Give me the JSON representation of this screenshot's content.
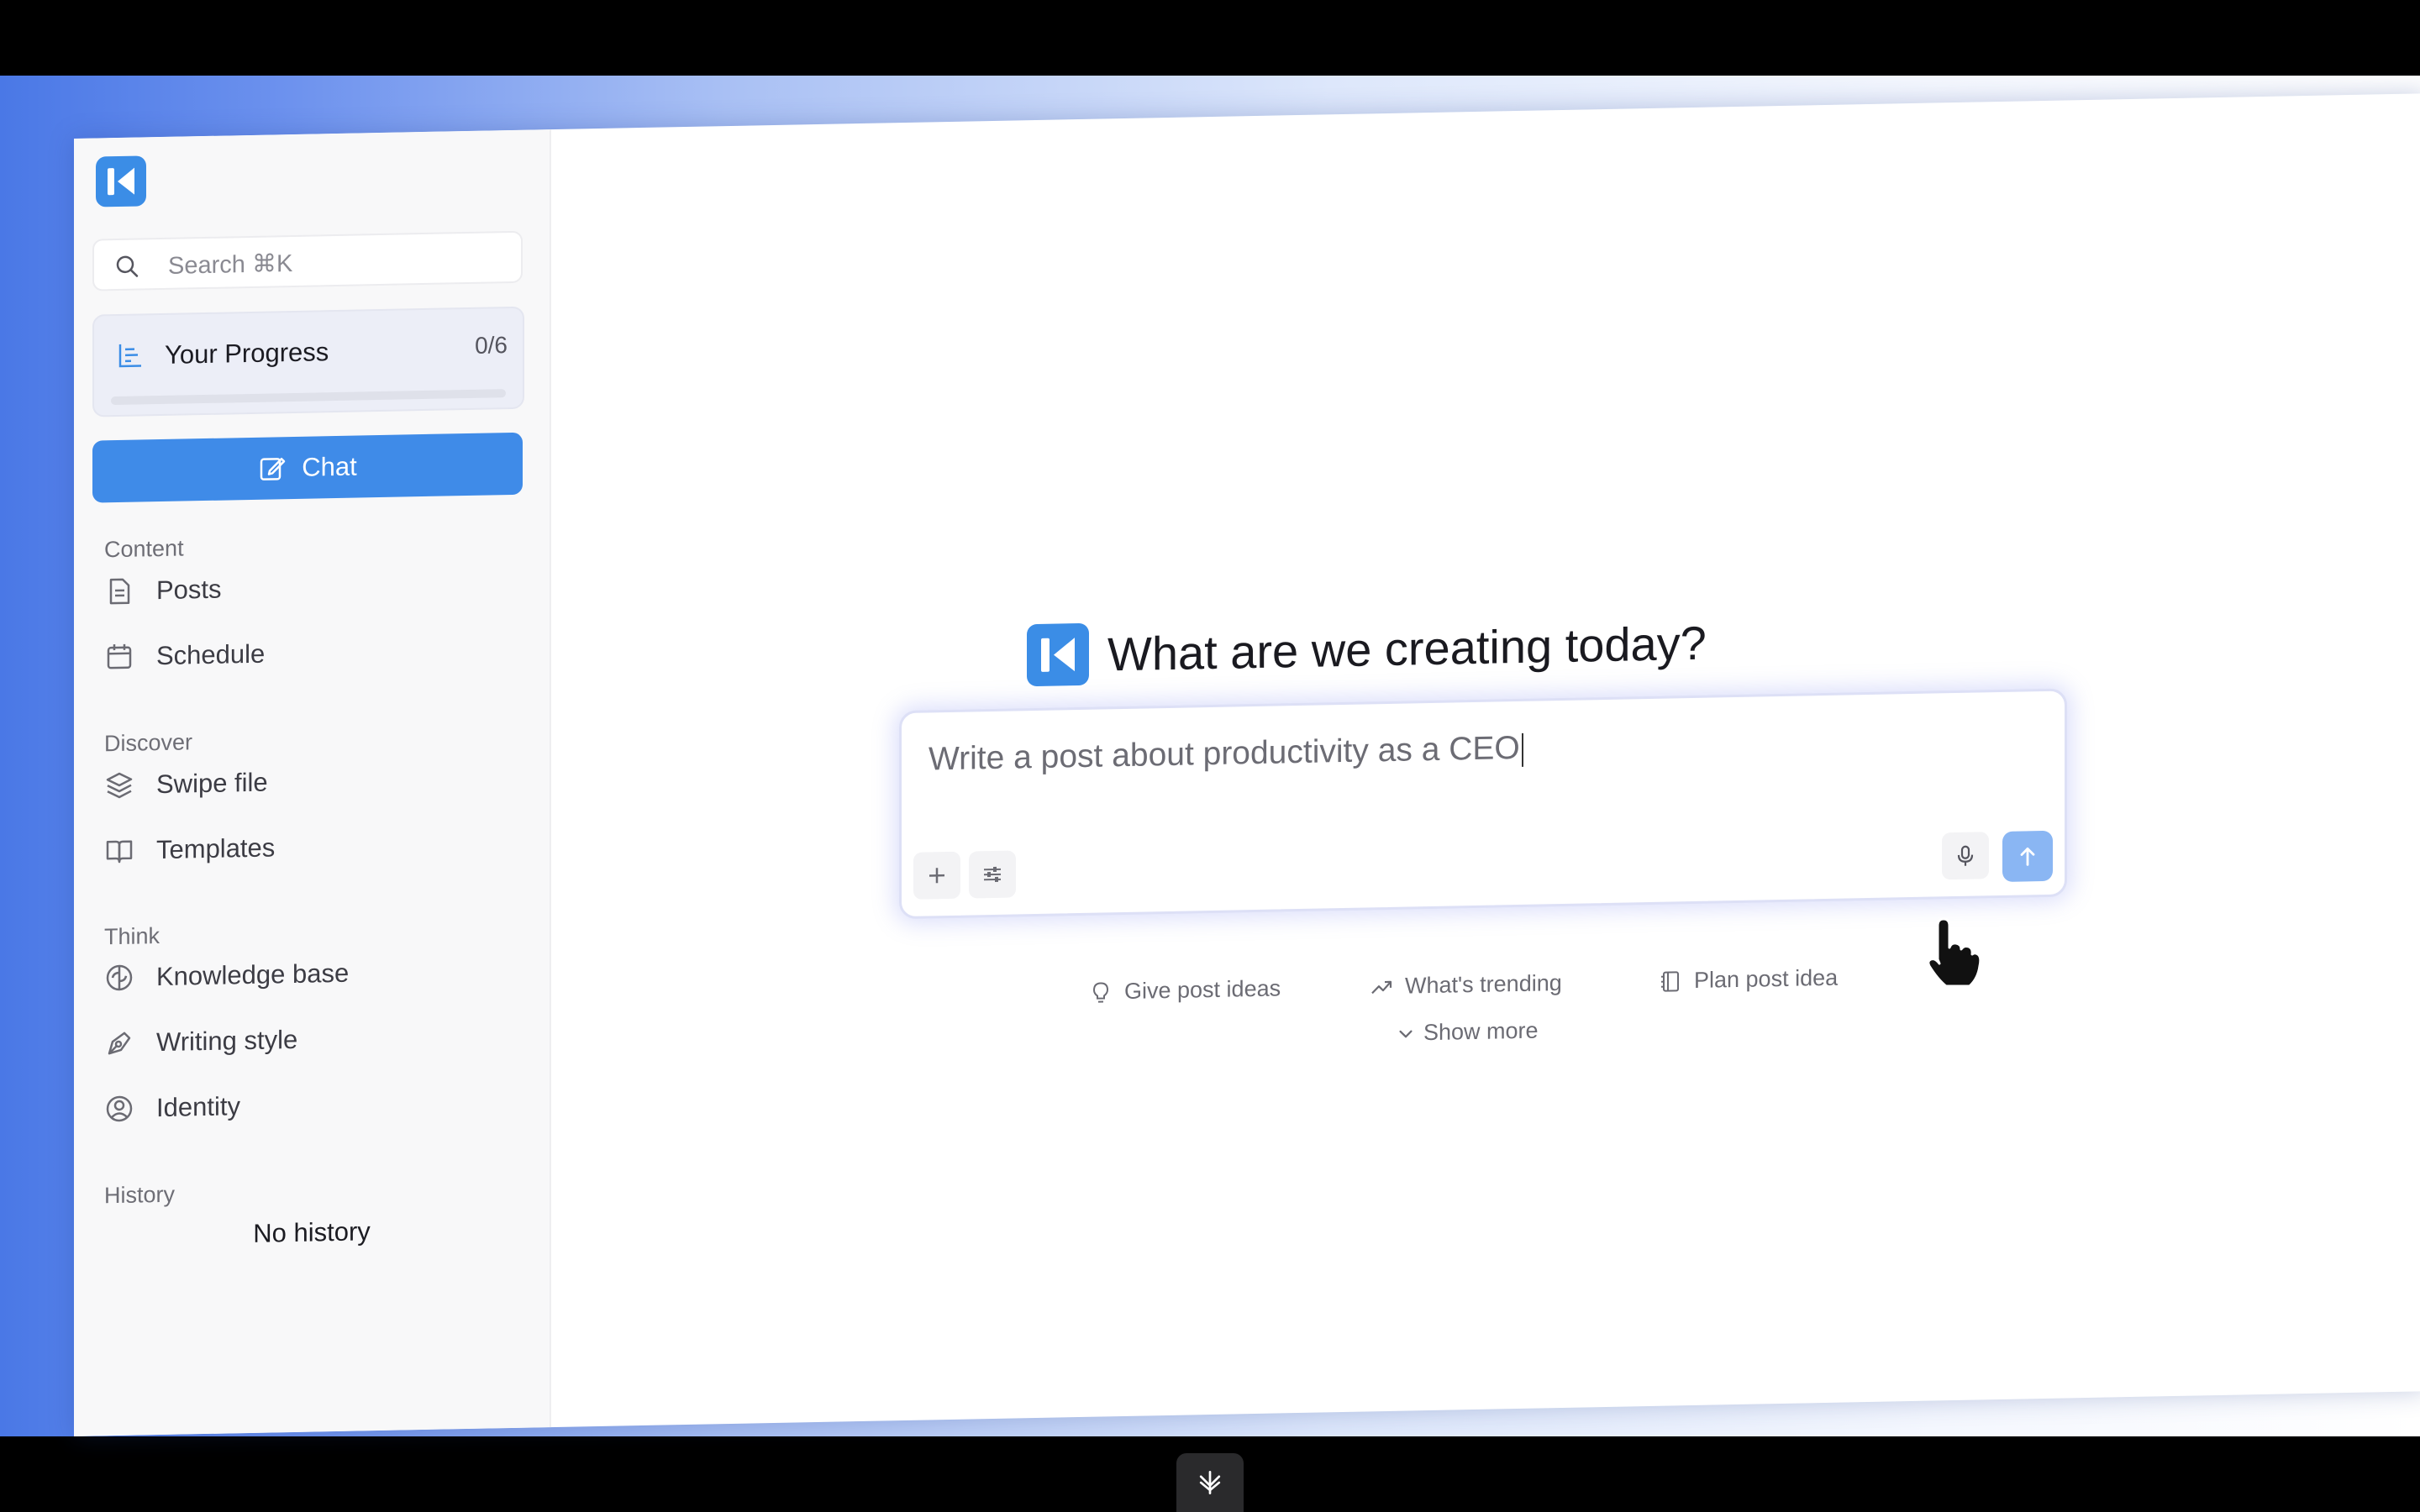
{
  "colors": {
    "accent": "#3f8be8",
    "send_button": "#8ab6f3",
    "sidebar_bg": "#f8f8f9"
  },
  "sidebar": {
    "search_placeholder": "Search ⌘K",
    "progress": {
      "label": "Your Progress",
      "count": "0/6",
      "fraction": 0
    },
    "chat_button": "Chat",
    "sections": [
      {
        "title": "Content",
        "items": [
          {
            "label": "Posts",
            "icon": "document-icon"
          },
          {
            "label": "Schedule",
            "icon": "calendar-icon"
          }
        ]
      },
      {
        "title": "Discover",
        "items": [
          {
            "label": "Swipe file",
            "icon": "layers-icon"
          },
          {
            "label": "Templates",
            "icon": "book-icon"
          }
        ]
      },
      {
        "title": "Think",
        "items": [
          {
            "label": "Knowledge base",
            "icon": "brain-icon"
          },
          {
            "label": "Writing style",
            "icon": "pen-nib-icon"
          },
          {
            "label": "Identity",
            "icon": "user-circle-icon"
          }
        ]
      },
      {
        "title": "History",
        "items": []
      }
    ],
    "history_empty": "No history"
  },
  "main": {
    "heading": "What are we creating today?",
    "composer_text": "Write a post about productivity as a CEO",
    "suggestions": [
      {
        "label": "Give post ideas",
        "icon": "lightbulb-icon"
      },
      {
        "label": "What's trending",
        "icon": "trending-up-icon"
      },
      {
        "label": "Plan post idea",
        "icon": "notebook-icon"
      }
    ],
    "show_more": "Show more"
  }
}
